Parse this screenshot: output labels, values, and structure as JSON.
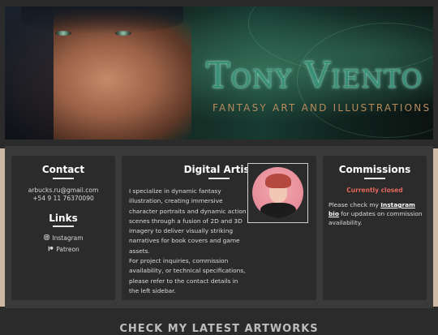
{
  "banner": {
    "brand": "Tony Viento",
    "tagline": "FANTASY ART AND ILLUSTRATIONS"
  },
  "contact": {
    "title": "Contact",
    "email": "arbucks.ru@gmail.com",
    "phone": "+54 9 11 76370090",
    "links_title": "Links",
    "links": [
      {
        "icon": "instagram-icon",
        "label": "Instagram"
      },
      {
        "icon": "patreon-icon",
        "label": "Patreon"
      }
    ]
  },
  "about": {
    "title": "Digital Artist",
    "paragraph1": "I specialize in dynamic fantasy illustration, creating immersive character portraits and dynamic action scenes through a fusion of 2D and 3D imagery to deliver visually striking narratives for book covers and game assets.",
    "paragraph2": "For project inquiries, commission availability, or technical specifications, please refer to the contact details in the left sidebar."
  },
  "commissions": {
    "title": "Commissions",
    "status": "Currently closed",
    "text_before": "Please check my",
    "link_label": "Instagram bio",
    "text_after": "for updates on commission availability."
  },
  "section": {
    "latest_heading": "CHECK MY LATEST ARTWORKS"
  },
  "colors": {
    "card_bg": "#2b2b2b",
    "strip_bg": "#3a3a3a",
    "status_red": "#e2675b",
    "brand_green": "#3a8f77",
    "tagline_gold": "#b58b5d"
  }
}
